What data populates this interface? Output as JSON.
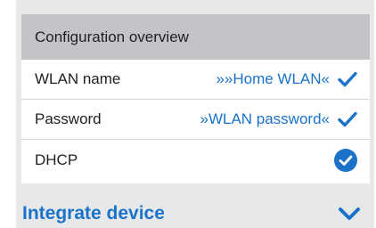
{
  "overview": {
    "title": "Configuration overview",
    "rows": [
      {
        "label": "WLAN name",
        "value": "»»Home WLAN«",
        "status_icon": "check-icon"
      },
      {
        "label": "Password",
        "value": "»WLAN password«",
        "status_icon": "check-icon"
      },
      {
        "label": "DHCP",
        "value": "",
        "status_icon": "check-circle-icon"
      }
    ]
  },
  "section": {
    "title": "Integrate device",
    "toggle_icon": "chevron-down-icon"
  },
  "colors": {
    "accent": "#1a73c9",
    "header_bg": "#c2c4c7",
    "frame_bg": "#e7e8e9"
  }
}
